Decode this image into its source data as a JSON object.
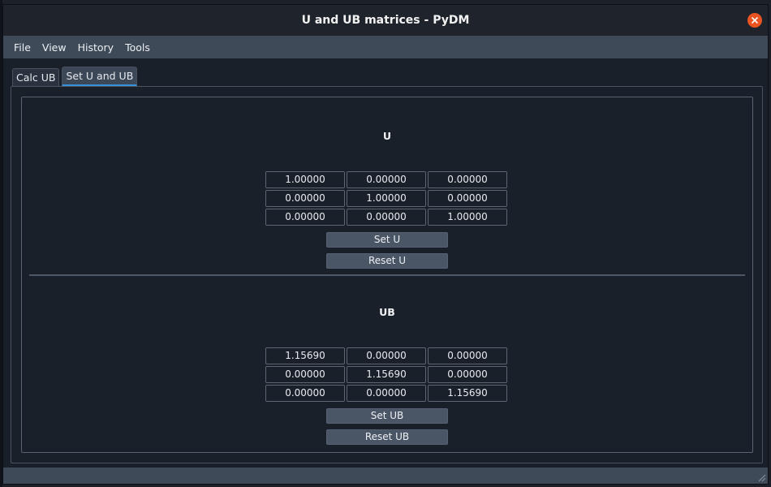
{
  "window": {
    "title": "U and UB matrices - PyDM"
  },
  "menu": [
    "File",
    "View",
    "History",
    "Tools"
  ],
  "tabs": [
    {
      "label": "Calc UB",
      "active": false
    },
    {
      "label": "Set U and UB",
      "active": true
    }
  ],
  "u_section": {
    "title": "U",
    "matrix": [
      [
        "1.00000",
        "0.00000",
        "0.00000"
      ],
      [
        "0.00000",
        "1.00000",
        "0.00000"
      ],
      [
        "0.00000",
        "0.00000",
        "1.00000"
      ]
    ],
    "set_label": "Set U",
    "reset_label": "Reset U"
  },
  "ub_section": {
    "title": "UB",
    "matrix": [
      [
        "1.15690",
        "0.00000",
        "0.00000"
      ],
      [
        "0.00000",
        "1.15690",
        "0.00000"
      ],
      [
        "0.00000",
        "0.00000",
        "1.15690"
      ]
    ],
    "set_label": "Set UB",
    "reset_label": "Reset UB"
  },
  "colors": {
    "accent": "#3a8fd6",
    "close": "#e95420"
  }
}
